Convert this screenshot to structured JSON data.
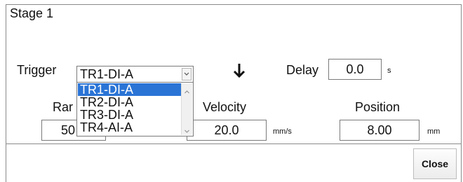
{
  "stage": {
    "title": "Stage 1"
  },
  "trigger": {
    "label": "Trigger",
    "selected": "TR1-DI-A",
    "options": [
      "TR1-DI-A",
      "TR2-DI-A",
      "TR3-DI-A",
      "TR4-AI-A"
    ]
  },
  "direction_icon": "down-arrow-icon",
  "delay": {
    "label": "Delay",
    "value": "0.0",
    "unit": "s"
  },
  "ramp": {
    "label_visible": "Rar",
    "value_visible": "50"
  },
  "velocity": {
    "label": "Velocity",
    "value": "20.0",
    "unit": "mm/s"
  },
  "position": {
    "label": "Position",
    "value": "8.00",
    "unit": "mm"
  },
  "close_button": {
    "label": "Close"
  },
  "colors": {
    "selection": "#2a74d6",
    "border": "#7a7a7a"
  }
}
